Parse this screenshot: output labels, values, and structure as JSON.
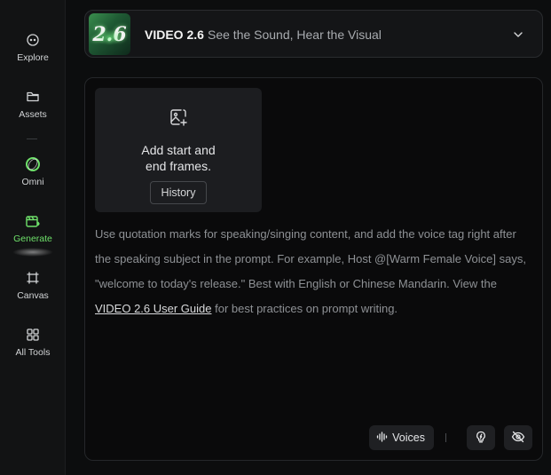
{
  "sidebar": {
    "items": [
      {
        "label": "Explore",
        "icon": "explore-icon"
      },
      {
        "label": "Assets",
        "icon": "folder-icon"
      },
      {
        "label": "Omni",
        "icon": "omni-ring-icon"
      },
      {
        "label": "Generate",
        "icon": "generate-icon",
        "active": true
      },
      {
        "label": "Canvas",
        "icon": "canvas-icon"
      },
      {
        "label": "All Tools",
        "icon": "grid-icon"
      }
    ]
  },
  "model": {
    "thumbnail_text": "2.6",
    "name": "VIDEO 2.6",
    "tagline": "See the Sound, Hear the Visual"
  },
  "frames": {
    "line1": "Add start and",
    "line2": "end frames.",
    "history_label": "History"
  },
  "hint": {
    "text": "Use quotation marks for speaking/singing content, and add the voice tag right after the speaking subject in the prompt. For example, Host @[Warm Female Voice] says, \"welcome to today's release.\" Best with English or Chinese Mandarin. View the ",
    "link": "VIDEO 2.6 User Guide",
    "suffix": " for best practices on prompt writing."
  },
  "toolbar": {
    "voices_label": "Voices"
  },
  "colors": {
    "accent": "#6ee06a",
    "background": "#0c0d0e",
    "panel": "#0a0a0b"
  }
}
